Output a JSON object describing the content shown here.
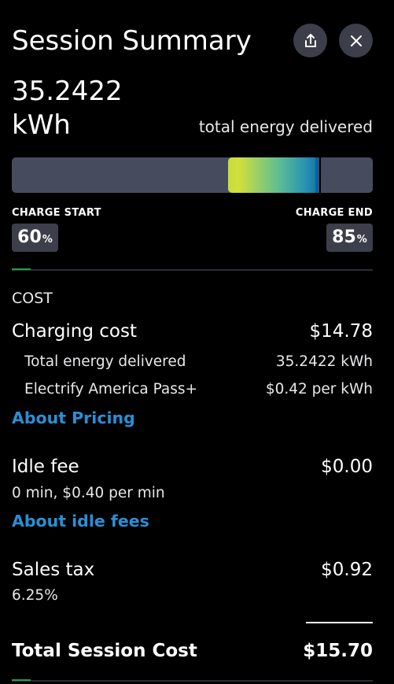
{
  "header": {
    "title": "Session Summary",
    "share_icon": "share-icon",
    "close_icon": "close-icon"
  },
  "energy": {
    "value": "35.2422",
    "unit": "kWh",
    "caption": "total energy delivered"
  },
  "charge": {
    "start_label": "CHARGE START",
    "end_label": "CHARGE END",
    "start_percent": "60",
    "end_percent": "85",
    "percent_sign": "%",
    "start_fraction": 0.6,
    "end_fraction": 0.85,
    "gradient_colors": [
      "#c6de3a",
      "#5fbf92",
      "#0f74a6"
    ]
  },
  "cost": {
    "section_label": "COST",
    "charging_cost": {
      "label": "Charging cost",
      "value": "$14.78",
      "energy_label": "Total energy delivered",
      "energy_value": "35.2422 kWh",
      "plan_label": "Electrify America Pass+",
      "plan_rate": "$0.42 per kWh",
      "link": "About Pricing"
    },
    "idle_fee": {
      "label": "Idle fee",
      "value": "$0.00",
      "detail": "0 min, $0.40 per min",
      "link": "About idle fees"
    },
    "sales_tax": {
      "label": "Sales tax",
      "value": "$0.92",
      "rate": "6.25%"
    },
    "total": {
      "label": "Total Session Cost",
      "value": "$15.70"
    }
  },
  "colors": {
    "background": "#000000",
    "panel": "#474b5e",
    "button": "#3c3e49",
    "link": "#2a8fd6",
    "accent": "#1fa34a"
  }
}
